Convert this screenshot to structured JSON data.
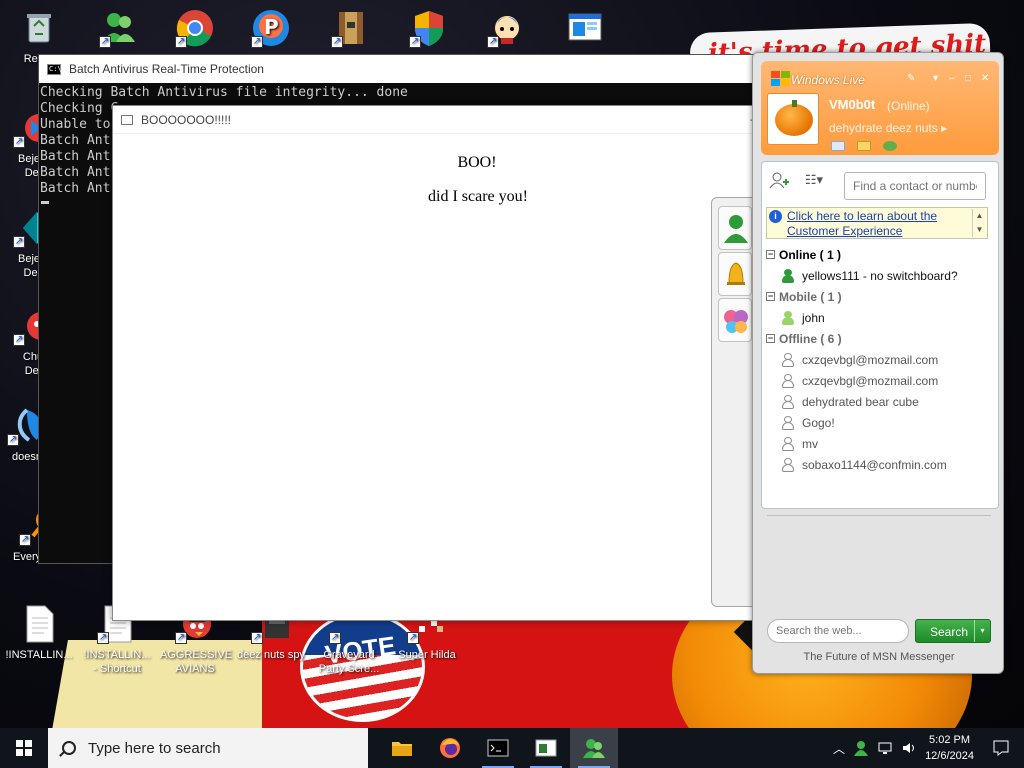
{
  "desktop": {
    "banner_text": "it's time to get shit",
    "wallpaper_vote_text": "VOTE",
    "icons": [
      {
        "label": "Recycle Bin",
        "visible_label": "Recyc"
      },
      {
        "label": "Bejew Del",
        "visible_label": "Bejew\nDel"
      },
      {
        "label": "Bejew Deli",
        "visible_label": "Bejew\nDeli"
      },
      {
        "label": "Chu Del",
        "visible_label": "Chu\nDel"
      },
      {
        "label": "doesn",
        "visible_label": "doesn"
      },
      {
        "label": "Everything",
        "visible_label": "Everything"
      },
      {
        "label": "!INSTALLIN...",
        "visible_label": "!INSTALLIN..."
      },
      {
        "label": "!INSTALLIN... - Shortcut",
        "visible_label": "!INSTALLIN...\n- Shortcut"
      },
      {
        "label": "AGGRESSIVE AVIANS",
        "visible_label": "AGGRESSIVE\nAVIANS"
      },
      {
        "label": "deez nuts spy",
        "visible_label": "deez nuts spy"
      },
      {
        "label": "Graveyard Party Scre...",
        "visible_label": "Graveyard\nParty Scre..."
      },
      {
        "label": "Super Hilda",
        "visible_label": "Super Hilda"
      }
    ]
  },
  "console": {
    "title": "Batch Antivirus Real-Time Protection",
    "lines": [
      "Checking Batch Antivirus file integrity... done",
      "Checking C",
      "Unable to",
      "Batch Ant",
      "Batch Ant",
      "Batch Ant",
      "Batch Ant"
    ]
  },
  "boo_window": {
    "title": "BOOOOOOO!!!!!",
    "heading": "BOO!",
    "message": "did I scare you!",
    "minimize_label": "–"
  },
  "messenger": {
    "brand": "Windows Live",
    "display_name": "VM0b0t",
    "status": "(Online)",
    "personal_message": "dehydrate deez nuts",
    "status_arrow": "▸",
    "contact_search_placeholder": "Find a contact or number",
    "customer_experience_link": "Click here to learn about the Customer Experience",
    "groups": [
      {
        "name": "Online ( 1 )",
        "state": "online",
        "contacts": [
          {
            "name": "yellows111 - no switchboard?"
          }
        ]
      },
      {
        "name": "Mobile ( 1 )",
        "state": "mobile",
        "contacts": [
          {
            "name": "john"
          }
        ]
      },
      {
        "name": "Offline ( 6 )",
        "state": "offline",
        "contacts": [
          {
            "name": "cxzqevbgl@mozmail.com"
          },
          {
            "name": "cxzqevbgl@mozmail.com"
          },
          {
            "name": "dehydrated bear cube"
          },
          {
            "name": "Gogo!"
          },
          {
            "name": "mv"
          },
          {
            "name": "sobaxo1144@confmin.com"
          }
        ]
      }
    ],
    "web_search_placeholder": "Search the web...",
    "search_button": "Search",
    "footer": "The Future of MSN Messenger"
  },
  "taskbar": {
    "search_placeholder": "Type here to search",
    "time": "5:02 PM",
    "date": "12/6/2024"
  },
  "colors": {
    "msn_orange": "#ff9b3c",
    "msn_green": "#2f9a3a",
    "link_blue": "#1a3fb7",
    "taskbar": "#10141b"
  }
}
